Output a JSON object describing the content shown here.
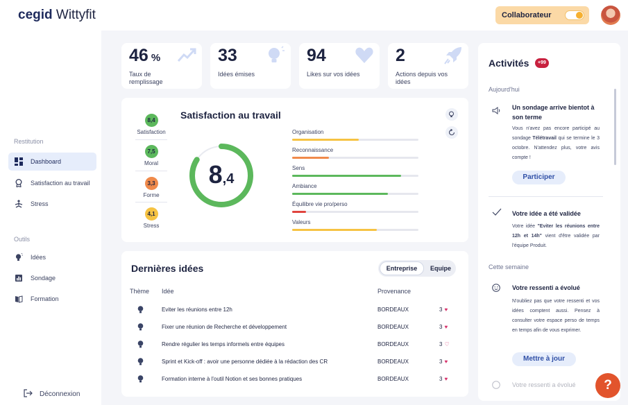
{
  "header": {
    "logo_brand": "cegid",
    "logo_product": "Wittyfit",
    "role_label": "Collaborateur"
  },
  "sidebar": {
    "sections": [
      {
        "title": "Restitution",
        "items": [
          {
            "label": "Dashboard",
            "icon": "dashboard-icon",
            "active": true
          },
          {
            "label": "Satisfaction au travail",
            "icon": "ribbon-icon"
          },
          {
            "label": "Stress",
            "icon": "meditation-icon"
          }
        ]
      },
      {
        "title": "Outils",
        "items": [
          {
            "label": "Idées",
            "icon": "bulb-icon"
          },
          {
            "label": "Sondage",
            "icon": "poll-icon"
          },
          {
            "label": "Formation",
            "icon": "book-icon"
          }
        ]
      }
    ],
    "logout_label": "Déconnexion"
  },
  "stats": [
    {
      "value": "46",
      "unit": "%",
      "label": "Taux de remplissage",
      "icon": "trend-up-icon"
    },
    {
      "value": "33",
      "unit": "",
      "label": "Idées émises",
      "icon": "bulb-icon"
    },
    {
      "value": "94",
      "unit": "",
      "label": "Likes sur vos idées",
      "icon": "heart-icon"
    },
    {
      "value": "2",
      "unit": "",
      "label": "Actions depuis vos idées",
      "icon": "rocket-icon"
    }
  ],
  "satisfaction": {
    "title": "Satisfaction au travail",
    "score_int": "8",
    "score_dec": ",4",
    "score_fraction": 0.84,
    "indicators": [
      {
        "value": "8,4",
        "label": "Satisfaction",
        "color": "#5cb85c"
      },
      {
        "value": "7,5",
        "label": "Moral",
        "color": "#5cb85c"
      },
      {
        "value": "3,3",
        "label": "Forme",
        "color": "#f08a4b"
      },
      {
        "value": "4,1",
        "label": "Stress",
        "color": "#f6c343"
      }
    ],
    "bars": [
      {
        "label": "Organisation",
        "value": 0.53,
        "color": "#f6c343"
      },
      {
        "label": "Reconnaissance",
        "value": 0.29,
        "color": "#f08a4b"
      },
      {
        "label": "Sens",
        "value": 0.86,
        "color": "#5cb85c"
      },
      {
        "label": "Ambiance",
        "value": 0.76,
        "color": "#5cb85c"
      },
      {
        "label": "Équilibre vie pro/perso",
        "value": 0.11,
        "color": "#e0443e"
      },
      {
        "label": "Valeurs",
        "value": 0.67,
        "color": "#f6c343"
      }
    ]
  },
  "ideas": {
    "title": "Dernières idées",
    "tabs": [
      "Entreprise",
      "Equipe"
    ],
    "columns": {
      "theme": "Thème",
      "idea": "Idée",
      "source": "Provenance"
    },
    "rows": [
      {
        "text": "Eviter les réunions entre 12h",
        "source": "BORDEAUX",
        "likes": "3",
        "liked": true
      },
      {
        "text": "Fixer une réunion de Recherche et développement",
        "source": "BORDEAUX",
        "likes": "3",
        "liked": true
      },
      {
        "text": "Rendre régulier les temps informels entre équipes",
        "source": "BORDEAUX",
        "likes": "3",
        "liked": false
      },
      {
        "text": "Sprint et Kick-off : avoir une personne dédiée à la rédaction des CR",
        "source": "BORDEAUX",
        "likes": "3",
        "liked": true
      },
      {
        "text": "Formation interne à l'outil Notion et ses bonnes pratiques",
        "source": "BORDEAUX",
        "likes": "3",
        "liked": true
      }
    ]
  },
  "activities": {
    "title": "Activités",
    "badge": "+99",
    "today_label": "Aujourd'hui",
    "week_label": "Cette semaine",
    "items": [
      {
        "icon": "megaphone-icon",
        "title": "Un sondage arrive bientot à son terme",
        "body_1": "Vous n'avez pas encore participé au sondage ",
        "body_bold": "Télétravail",
        "body_2": " qui se termine le 3 octobre. N'attendez plus, votre avis compte !",
        "button": "Participer"
      },
      {
        "icon": "check-icon",
        "title": "Votre idée a été validée",
        "body_1": "Votre idée ",
        "body_bold": "\"Eviter les réunions entre 12h et 14h\"",
        "body_2": " vient d'être validée par l'équipe Produit."
      },
      {
        "icon": "smiley-icon",
        "title": "Votre ressenti a évolué",
        "body": "N'oubliez pas que votre ressenti et vos idées comptent aussi. Pensez à consulter votre espace perso de temps en temps afin de vous exprimer.",
        "button": "Mettre à jour"
      },
      {
        "icon": "smiley-icon",
        "title": "Votre ressenti a évolué"
      }
    ]
  },
  "help_label": "?"
}
